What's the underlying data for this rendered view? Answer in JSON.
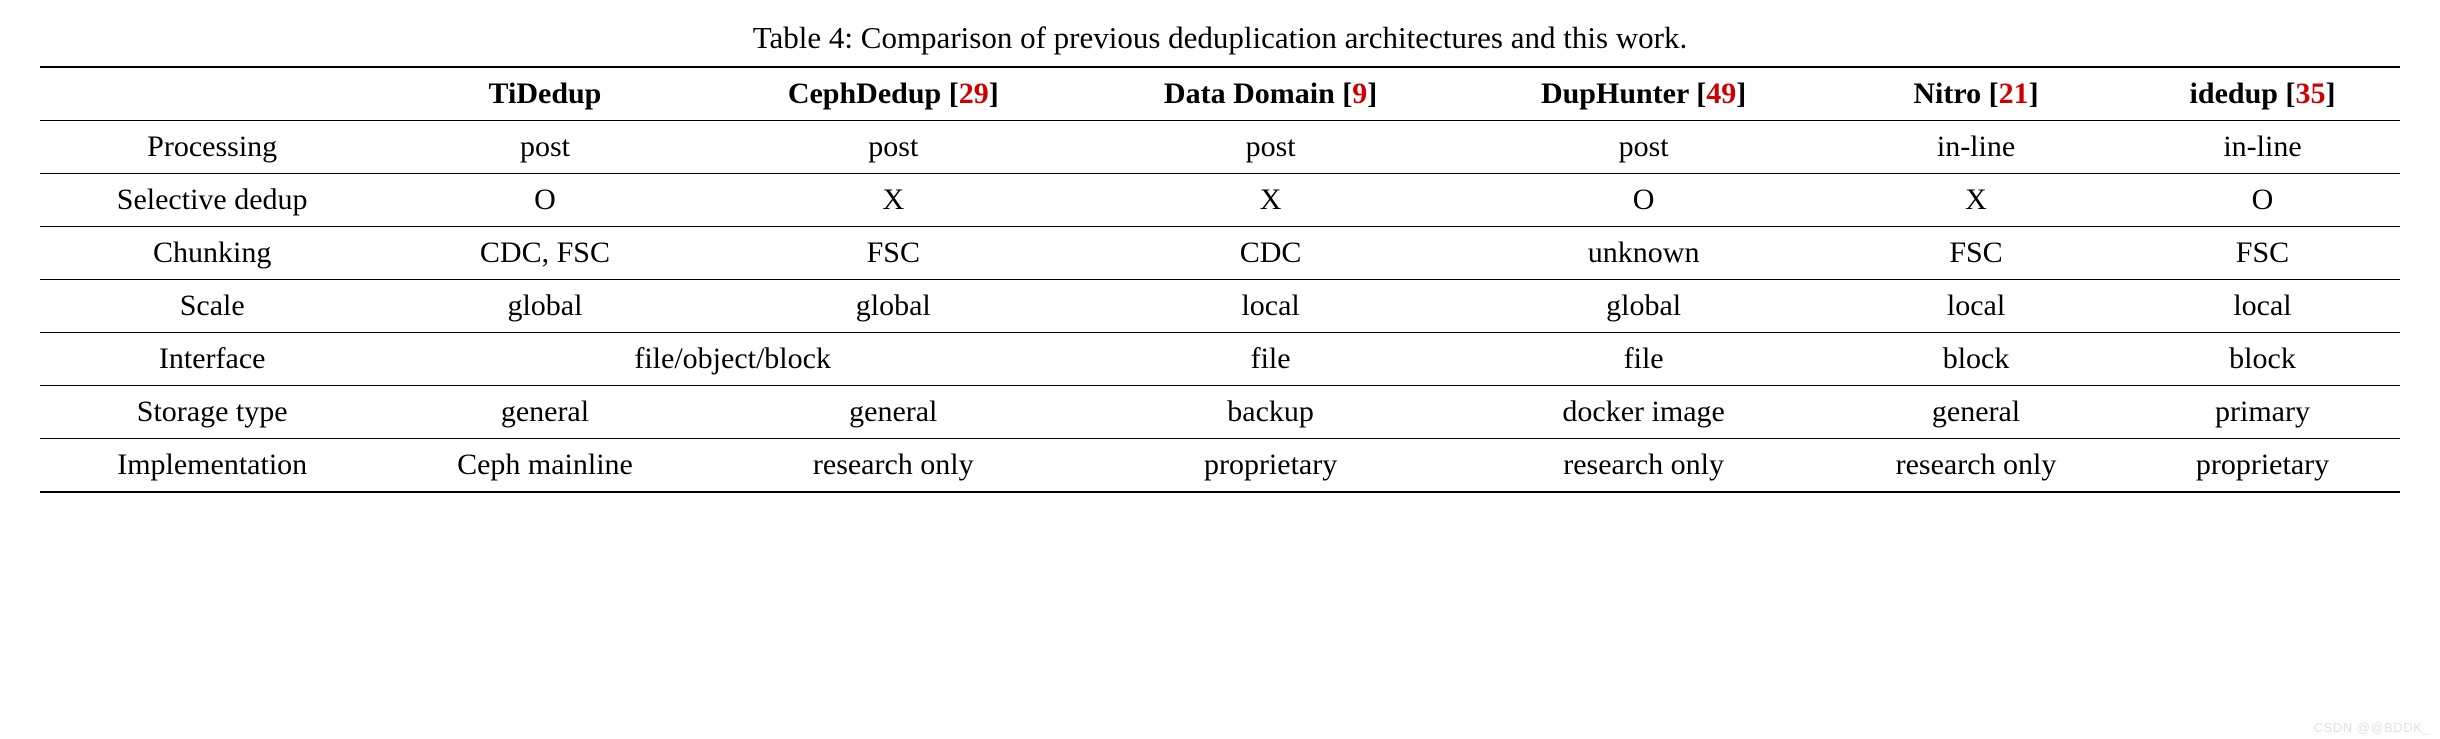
{
  "caption": "Table 4: Comparison of previous deduplication architectures and this work.",
  "columns": {
    "c1": "TiDedup",
    "c2_name": "CephDedup [",
    "c2_ref": "29",
    "c2_close": "]",
    "c3_name": "Data Domain [",
    "c3_ref": "9",
    "c3_close": "]",
    "c4_name": "DupHunter [",
    "c4_ref": "49",
    "c4_close": "]",
    "c5_name": "Nitro [",
    "c5_ref": "21",
    "c5_close": "]",
    "c6_name": "idedup [",
    "c6_ref": "35",
    "c6_close": "]"
  },
  "rows": {
    "processing": {
      "label": "Processing",
      "v1": "post",
      "v2": "post",
      "v3": "post",
      "v4": "post",
      "v5": "in-line",
      "v6": "in-line"
    },
    "selective": {
      "label": "Selective dedup",
      "v1": "O",
      "v2": "X",
      "v3": "X",
      "v4": "O",
      "v5": "X",
      "v6": "O"
    },
    "chunking": {
      "label": "Chunking",
      "v1": "CDC, FSC",
      "v2": "FSC",
      "v3": "CDC",
      "v4": "unknown",
      "v5": "FSC",
      "v6": "FSC"
    },
    "scale": {
      "label": "Scale",
      "v1": "global",
      "v2": "global",
      "v3": "local",
      "v4": "global",
      "v5": "local",
      "v6": "local"
    },
    "interface": {
      "label": "Interface",
      "v12": "file/object/block",
      "v3": "file",
      "v4": "file",
      "v5": "block",
      "v6": "block"
    },
    "storage": {
      "label": "Storage type",
      "v1": "general",
      "v2": "general",
      "v3": "backup",
      "v4": "docker image",
      "v5": "general",
      "v6": "primary"
    },
    "impl": {
      "label": "Implementation",
      "v1": "Ceph mainline",
      "v2": "research only",
      "v3": "proprietary",
      "v4": "research only",
      "v5": "research only",
      "v6": "proprietary"
    }
  },
  "chart_data": {
    "type": "table",
    "title": "Table 4: Comparison of previous deduplication architectures and this work.",
    "columns": [
      "",
      "TiDedup",
      "CephDedup [29]",
      "Data Domain [9]",
      "DupHunter [49]",
      "Nitro [21]",
      "idedup [35]"
    ],
    "rows": [
      [
        "Processing",
        "post",
        "post",
        "post",
        "post",
        "in-line",
        "in-line"
      ],
      [
        "Selective dedup",
        "O",
        "X",
        "X",
        "O",
        "X",
        "O"
      ],
      [
        "Chunking",
        "CDC, FSC",
        "FSC",
        "CDC",
        "unknown",
        "FSC",
        "FSC"
      ],
      [
        "Scale",
        "global",
        "global",
        "local",
        "global",
        "local",
        "local"
      ],
      [
        "Interface",
        "file/object/block",
        "file/object/block",
        "file",
        "file",
        "block",
        "block"
      ],
      [
        "Storage type",
        "general",
        "general",
        "backup",
        "docker image",
        "general",
        "primary"
      ],
      [
        "Implementation",
        "Ceph mainline",
        "research only",
        "proprietary",
        "research only",
        "research only",
        "proprietary"
      ]
    ]
  },
  "watermark": "CSDN @@BDDK_"
}
